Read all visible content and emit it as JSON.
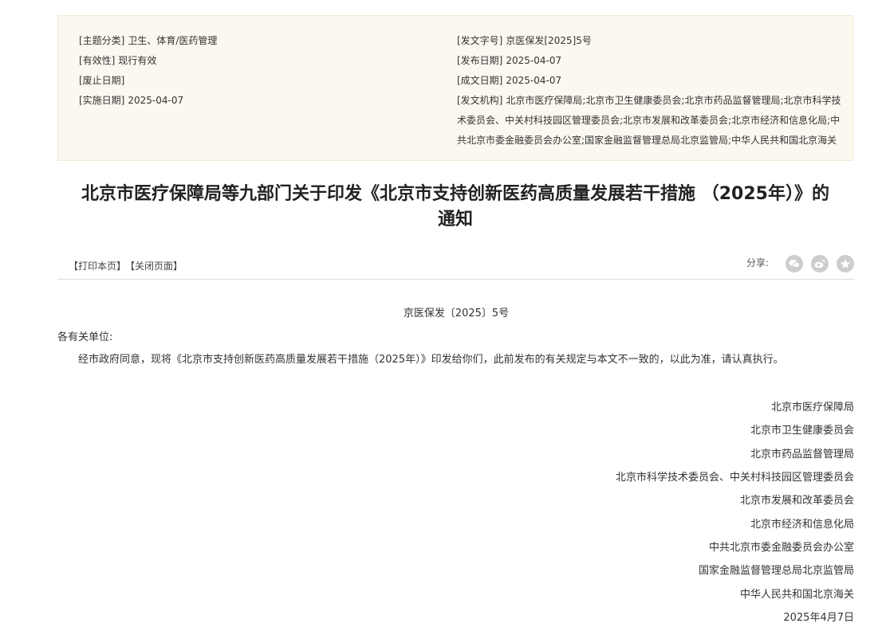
{
  "meta": {
    "left": [
      {
        "key": "[主题分类]",
        "value": "卫生、体育/医药管理"
      },
      {
        "key": "[有效性]",
        "value": "现行有效"
      },
      {
        "key": "[废止日期]",
        "value": ""
      },
      {
        "key": "[实施日期]",
        "value": "2025-04-07"
      }
    ],
    "right": [
      {
        "key": "[发文字号]",
        "value": "京医保发[2025]5号"
      },
      {
        "key": "[发布日期]",
        "value": "2025-04-07"
      },
      {
        "key": "[成文日期]",
        "value": "2025-04-07"
      }
    ],
    "issuer_key": "[发文机构]",
    "issuer_lines": [
      "北京市医疗保障局;北京市卫生健康委员会;北京市药品监督管理局;北京市科学技",
      "术委员会、中关村科技园区管理委员会;北京市发展和改革委员会;北京市经济和信息化局;中",
      "共北京市委金融委员会办公室;国家金融监督管理总局北京监管局;中华人民共和国北京海关"
    ]
  },
  "title_line1": "北京市医疗保障局等九部门关于印发《北京市支持创新医药高质量发展若干措施 （2025年）》的",
  "title_line2": "通知",
  "toolbar": {
    "print": "【打印本页】",
    "close": "【关闭页面】",
    "share_label": "分享:"
  },
  "share_icons": [
    "wechat-icon",
    "weibo-icon",
    "favorite-icon"
  ],
  "colors": {
    "meta_bg": "#fcf8ef",
    "share_icon_bg": "#cdcdcd"
  },
  "doc": {
    "number": "京医保发〔2025〕5号",
    "recipient": "各有关单位:",
    "body": "经市政府同意，现将《北京市支持创新医药高质量发展若干措施（2025年）》印发给你们，此前发布的有关规定与本文不一致的，以此为准，请认真执行。",
    "signatories": [
      "北京市医疗保障局",
      "北京市卫生健康委员会",
      "北京市药品监督管理局",
      "北京市科学技术委员会、中关村科技园区管理委员会",
      "北京市发展和改革委员会",
      "北京市经济和信息化局",
      "中共北京市委金融委员会办公室",
      "国家金融监督管理总局北京监管局",
      "中华人民共和国北京海关"
    ],
    "date": "2025年4月7日"
  }
}
